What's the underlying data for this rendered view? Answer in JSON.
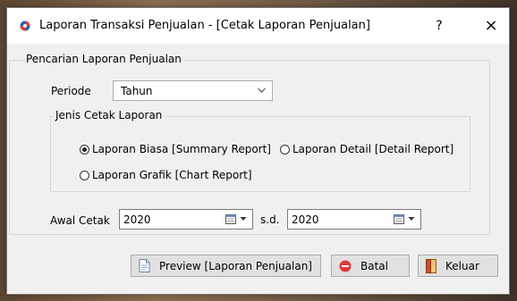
{
  "window": {
    "title": "Laporan Transaksi Penjualan - [Cetak Laporan Penjualan]",
    "help_label": "?",
    "close_label": "×"
  },
  "search_group": {
    "legend": "Pencarian Laporan Penjualan",
    "periode_label": "Periode",
    "periode_value": "Tahun"
  },
  "print_type_group": {
    "legend": "Jenis Cetak Laporan",
    "options": [
      {
        "label": "Laporan Biasa [Summary Report]",
        "selected": true
      },
      {
        "label": "Laporan Detail [Detail Report]",
        "selected": false
      },
      {
        "label": "Laporan Grafik [Chart Report]",
        "selected": false
      }
    ]
  },
  "date_range": {
    "start_label": "Awal Cetak",
    "start_value": "2020",
    "separator_label": "s.d.",
    "end_value": "2020"
  },
  "buttons": {
    "preview_label": "Preview [Laporan Penjualan]",
    "batal_label": "Batal",
    "keluar_label": "Keluar"
  },
  "colors": {
    "titlebar_bg": "#ffffff",
    "window_bg": "#f0f0f0",
    "app_icon_red": "#e0403a",
    "app_icon_blue": "#2a5db0",
    "batal_icon": "#e23b3b",
    "keluar_icon": "#c8502a"
  }
}
